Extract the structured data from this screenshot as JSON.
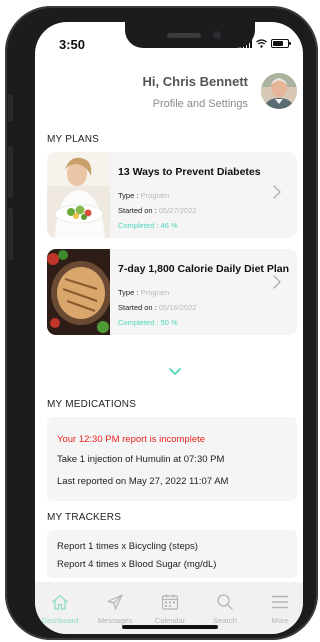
{
  "status_bar": {
    "time": "3:50"
  },
  "header": {
    "greeting": "Hi, Chris Bennett",
    "profile_link": "Profile and Settings"
  },
  "my_plans": {
    "title": "MY PLANS",
    "items": [
      {
        "title": "13 Ways to Prevent Diabetes",
        "type_label": "Type :",
        "type_value": "Program",
        "started_label": "Started on :",
        "started_value": "05/27/2022",
        "completed_label": "Completed :",
        "completed_value": "46 %",
        "completed_fraction": 0.46
      },
      {
        "title": "7-day 1,800 Calorie Daily Diet Plan",
        "type_label": "Type :",
        "type_value": "Program",
        "started_label": "Started on :",
        "started_value": "05/16/2022",
        "completed_label": "Completed :",
        "completed_value": "50 %",
        "completed_fraction": 0.5
      }
    ]
  },
  "my_medications": {
    "title": "MY MEDICATIONS",
    "alert": "Your 12:30 PM report is incomplete",
    "instruction": "Take 1 injection of Humulin at 07:30 PM",
    "last_reported": "Last reported on May 27, 2022 11:07 AM"
  },
  "my_trackers": {
    "title": "MY TRACKERS",
    "items": [
      "Report 1 times x Bicycling (steps)",
      "Report 4 times x Blood Sugar (mg/dL)"
    ]
  },
  "bottom_nav": {
    "items": [
      {
        "label": "Dashboard",
        "icon": "home-icon",
        "active": true
      },
      {
        "label": "Messages",
        "icon": "paper-plane-icon",
        "active": false
      },
      {
        "label": "Calendar",
        "icon": "calendar-icon",
        "active": false
      },
      {
        "label": "Search",
        "icon": "search-icon",
        "active": false
      },
      {
        "label": "More",
        "icon": "menu-icon",
        "active": false
      }
    ]
  },
  "colors": {
    "accent": "#4fd6b9",
    "alert": "#e8231f",
    "card_bg": "#f5f5f6",
    "muted": "#b9b9b9"
  }
}
